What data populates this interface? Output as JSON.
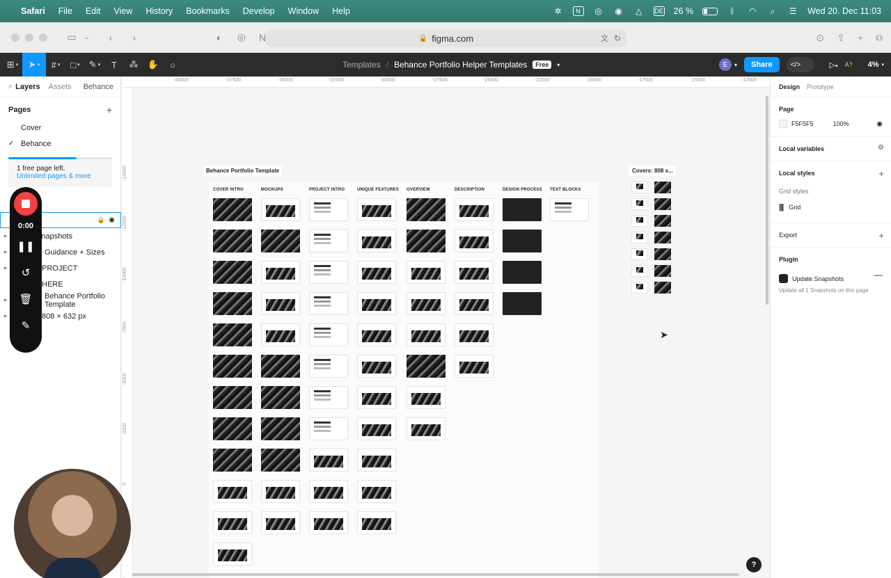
{
  "menubar": {
    "app": "Safari",
    "items": [
      "File",
      "Edit",
      "View",
      "History",
      "Bookmarks",
      "Develop",
      "Window",
      "Help"
    ],
    "input_source": "DE",
    "battery": "26 %",
    "datetime": "Wed 20. Dec  11:03"
  },
  "safari": {
    "url": "figma.com"
  },
  "figma_toolbar": {
    "breadcrumb_parent": "Templates",
    "file_name": "Behance Portfolio Helper Templates",
    "plan_badge": "Free",
    "avatar_initial": "E",
    "share_label": "Share",
    "zoom": "4%",
    "ai_label": "A?"
  },
  "left_panel": {
    "tabs": {
      "layers": "Layers",
      "assets": "Assets",
      "page_switch": "Behance"
    },
    "pages_header": "Pages",
    "pages": [
      "Cover",
      "Behance"
    ],
    "upgrade_line1": "1 free page left.",
    "upgrade_link": "Unlimited pages & more",
    "layers": [
      {
        "label": ""
      },
      {
        "label": "Snapshots"
      },
      {
        "label": "Guidance + Sizes"
      },
      {
        "label": "PROJECT"
      },
      {
        "label": "HERE"
      },
      {
        "label": "Behance Portfolio Template"
      },
      {
        "label": "808 × 632 px"
      }
    ]
  },
  "recorder": {
    "time": "0:00"
  },
  "canvas": {
    "ruler_top": [
      "-40000",
      "-37500",
      "-35000",
      "-32500",
      "-30000",
      "-27500",
      "-25000",
      "-22500",
      "-20000",
      "-17500",
      "-15000",
      "-12500"
    ],
    "ruler_left": [
      "-15000",
      "-12500",
      "-10000",
      "-7500",
      "-5000",
      "-2500",
      "0",
      "2500",
      "5000"
    ],
    "frame_title": "Behance Portfolio Template",
    "covers_title": "Covers: 808 x...",
    "columns": [
      "COVER INTRO",
      "MOCKUPS",
      "PROJECT INTRO",
      "UNIQUE FEATURES",
      "OVERVIEW",
      "DESCRIPTION",
      "DESIGN PROCESS",
      "TEXT BLOCKS"
    ]
  },
  "right_panel": {
    "tabs": {
      "design": "Design",
      "prototype": "Prototype"
    },
    "page_header": "Page",
    "page_color": "F5F5F5",
    "page_opacity": "100%",
    "local_variables": "Local variables",
    "local_styles": "Local styles",
    "grid_styles": "Grid styles",
    "grid_item": "Grid",
    "export": "Export",
    "plugin_header": "Plugin",
    "plugin_name": "Update Snapshots",
    "plugin_desc": "Update all 1 Snapshots on this page"
  },
  "icons": {
    "apple": "apple-icon",
    "lock": "lock-icon",
    "help": "help-icon"
  },
  "colors": {
    "figma_blue": "#0d99ff",
    "toolbar_bg": "#2c2c2c",
    "record_red": "#f24141",
    "canvas_bg": "#f5f5f5"
  }
}
